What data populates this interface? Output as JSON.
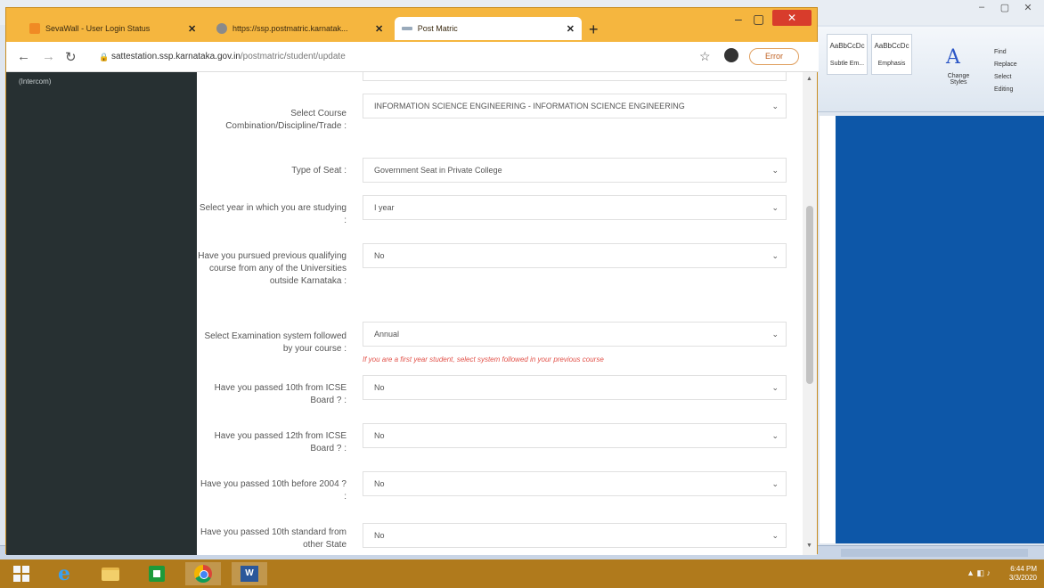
{
  "word": {
    "styles": [
      {
        "preview": "AaBbCcDc",
        "name": "Subtle Em..."
      },
      {
        "preview": "AaBbCcDc",
        "name": "Emphasis"
      }
    ],
    "change_styles": "Change Styles",
    "editing": [
      "Find",
      "Replace",
      "Select",
      "Editing"
    ]
  },
  "browser": {
    "tabs": [
      {
        "title": "SevaWall - User Login Status",
        "active": false
      },
      {
        "title": "https://ssp.postmatric.karnatak...",
        "active": false
      },
      {
        "title": "Post Matric",
        "active": true
      }
    ],
    "url_host": "sattestation.ssp.karnataka.gov.in",
    "url_path": "/postmatric/student/update",
    "error_label": "Error"
  },
  "sidebar": {
    "item": "(Intercom)"
  },
  "form": {
    "fields": [
      {
        "label": "Select Course Combination/Discipline/Trade :",
        "value": "INFORMATION SCIENCE ENGINEERING - INFORMATION SCIENCE ENGINEERING"
      },
      {
        "label": "Type of Seat :",
        "value": "Government Seat in Private College"
      },
      {
        "label": "Select year in which you are studying :",
        "value": "I year"
      },
      {
        "label": "Have you pursued previous qualifying course from any of the Universities outside Karnataka :",
        "value": "No"
      },
      {
        "label": "Select Examination system followed by your course :",
        "value": "Annual"
      },
      {
        "label": "Have you passed 10th from ICSE Board ? :",
        "value": "No"
      },
      {
        "label": "Have you passed 12th from ICSE Board ? :",
        "value": "No"
      },
      {
        "label": "Have you passed 10th before 2004 ? :",
        "value": "No"
      },
      {
        "label": "Have you passed 10th standard from other State",
        "value": "No"
      }
    ],
    "exam_hint": "If you are a first year student, select system followed in your previous course"
  },
  "taskbar": {
    "time": "6:44 PM",
    "date": "3/3/2020"
  },
  "colors": {
    "browser_frame": "#f5b63f",
    "sidebar": "#273032",
    "taskbar": "#b07a1c",
    "hint": "#e2534b"
  }
}
